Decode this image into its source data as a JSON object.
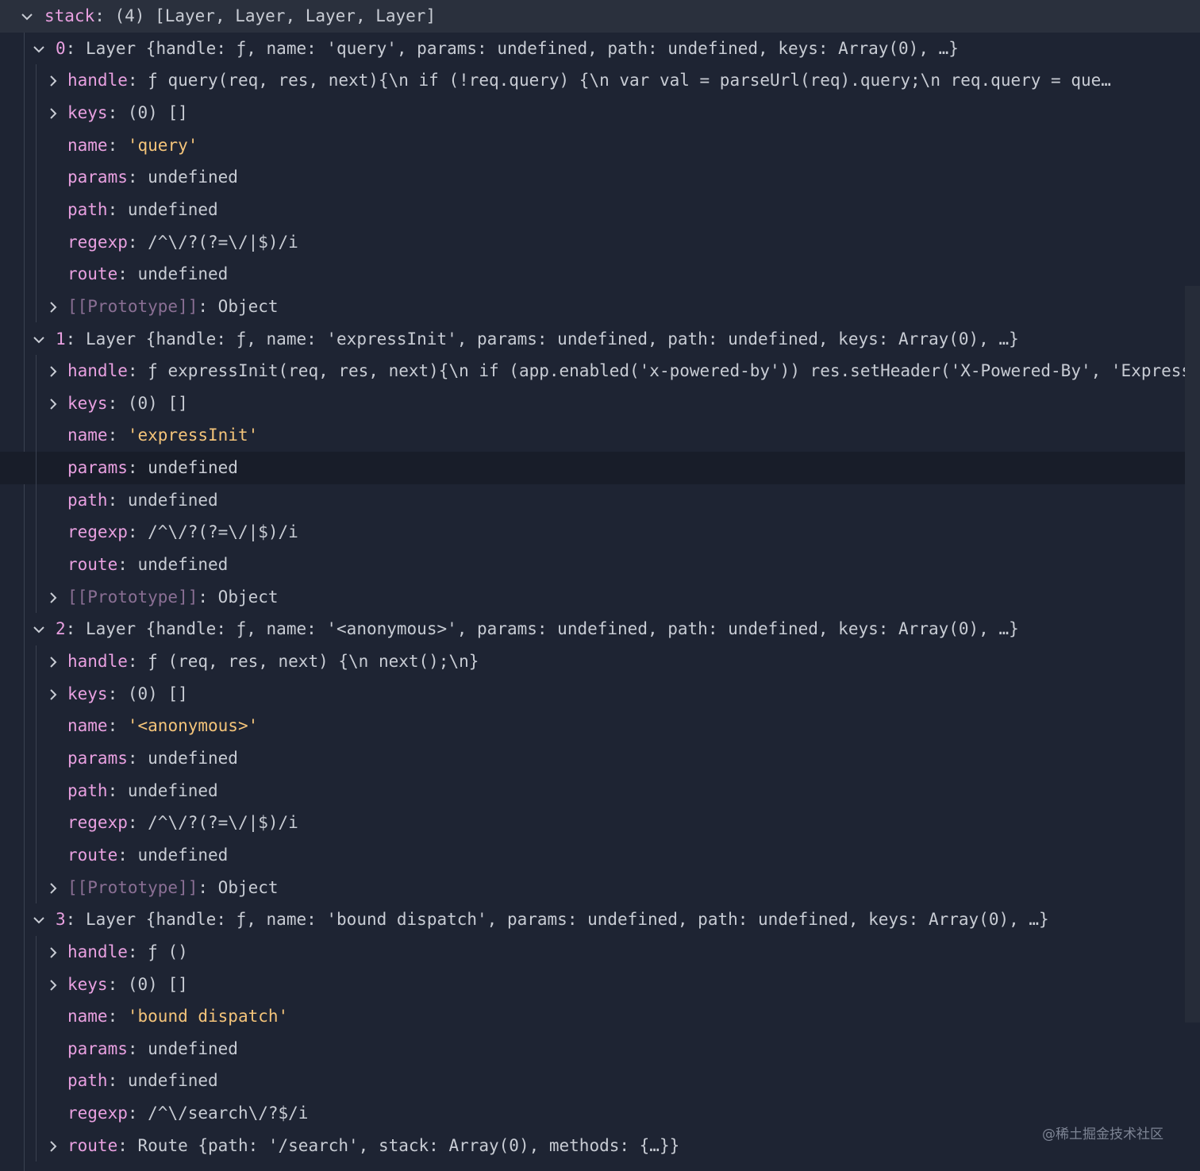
{
  "panel": {
    "root": {
      "key": "stack",
      "summary": "(4) [Layer, Layer, Layer, Layer]"
    },
    "layers": [
      {
        "index": "0",
        "summary": "Layer {handle: ƒ, name: 'query', params: undefined, path: undefined, keys: Array(0), …}",
        "props": [
          {
            "key": "handle",
            "value": "ƒ query(req, res, next){\\n    if (!req.query) {\\n      var val = parseUrl(req).query;\\n      req.query = que…",
            "expandable": true
          },
          {
            "key": "keys",
            "value": "(0) []",
            "expandable": true
          },
          {
            "key": "name",
            "value": "'query'",
            "expandable": false,
            "string": true
          },
          {
            "key": "params",
            "value": "undefined",
            "expandable": false
          },
          {
            "key": "path",
            "value": "undefined",
            "expandable": false
          },
          {
            "key": "regexp",
            "value": "/^\\/?(?=\\/|$)/i",
            "expandable": false
          },
          {
            "key": "route",
            "value": "undefined",
            "expandable": false
          },
          {
            "key": "[[Prototype]]",
            "value": "Object",
            "expandable": true,
            "dim": true
          }
        ]
      },
      {
        "index": "1",
        "summary": "Layer {handle: ƒ, name: 'expressInit', params: undefined, path: undefined, keys: Array(0), …}",
        "props": [
          {
            "key": "handle",
            "value": "ƒ expressInit(req, res, next){\\n    if (app.enabled('x-powered-by')) res.setHeader('X-Powered-By', 'Express'…",
            "expandable": true
          },
          {
            "key": "keys",
            "value": "(0) []",
            "expandable": true
          },
          {
            "key": "name",
            "value": "'expressInit'",
            "expandable": false,
            "string": true
          },
          {
            "key": "params",
            "value": "undefined",
            "expandable": false
          },
          {
            "key": "path",
            "value": "undefined",
            "expandable": false
          },
          {
            "key": "regexp",
            "value": "/^\\/?(?=\\/|$)/i",
            "expandable": false
          },
          {
            "key": "route",
            "value": "undefined",
            "expandable": false
          },
          {
            "key": "[[Prototype]]",
            "value": "Object",
            "expandable": true,
            "dim": true
          }
        ]
      },
      {
        "index": "2",
        "summary": "Layer {handle: ƒ, name: '<anonymous>', params: undefined, path: undefined, keys: Array(0), …}",
        "props": [
          {
            "key": "handle",
            "value": "ƒ (req, res, next) {\\n  next();\\n}",
            "expandable": true
          },
          {
            "key": "keys",
            "value": "(0) []",
            "expandable": true
          },
          {
            "key": "name",
            "value": "'<anonymous>'",
            "expandable": false,
            "string": true
          },
          {
            "key": "params",
            "value": "undefined",
            "expandable": false
          },
          {
            "key": "path",
            "value": "undefined",
            "expandable": false
          },
          {
            "key": "regexp",
            "value": "/^\\/?(?=\\/|$)/i",
            "expandable": false
          },
          {
            "key": "route",
            "value": "undefined",
            "expandable": false
          },
          {
            "key": "[[Prototype]]",
            "value": "Object",
            "expandable": true,
            "dim": true
          }
        ]
      },
      {
        "index": "3",
        "summary": "Layer {handle: ƒ, name: 'bound dispatch', params: undefined, path: undefined, keys: Array(0), …}",
        "props": [
          {
            "key": "handle",
            "value": "ƒ ()",
            "expandable": true
          },
          {
            "key": "keys",
            "value": "(0) []",
            "expandable": true
          },
          {
            "key": "name",
            "value": "'bound dispatch'",
            "expandable": false,
            "string": true
          },
          {
            "key": "params",
            "value": "undefined",
            "expandable": false
          },
          {
            "key": "path",
            "value": "undefined",
            "expandable": false
          },
          {
            "key": "regexp",
            "value": "/^\\/search\\/?$/i",
            "expandable": false
          },
          {
            "key": "route",
            "value": "Route {path: '/search', stack: Array(0), methods: {…}}",
            "expandable": true
          }
        ]
      }
    ]
  },
  "watermark": "@稀土掘金技术社区",
  "colors": {
    "background": "#1e2433",
    "key": "#e8a0e0",
    "string": "#f4c47a",
    "text": "#c8ccd4"
  }
}
